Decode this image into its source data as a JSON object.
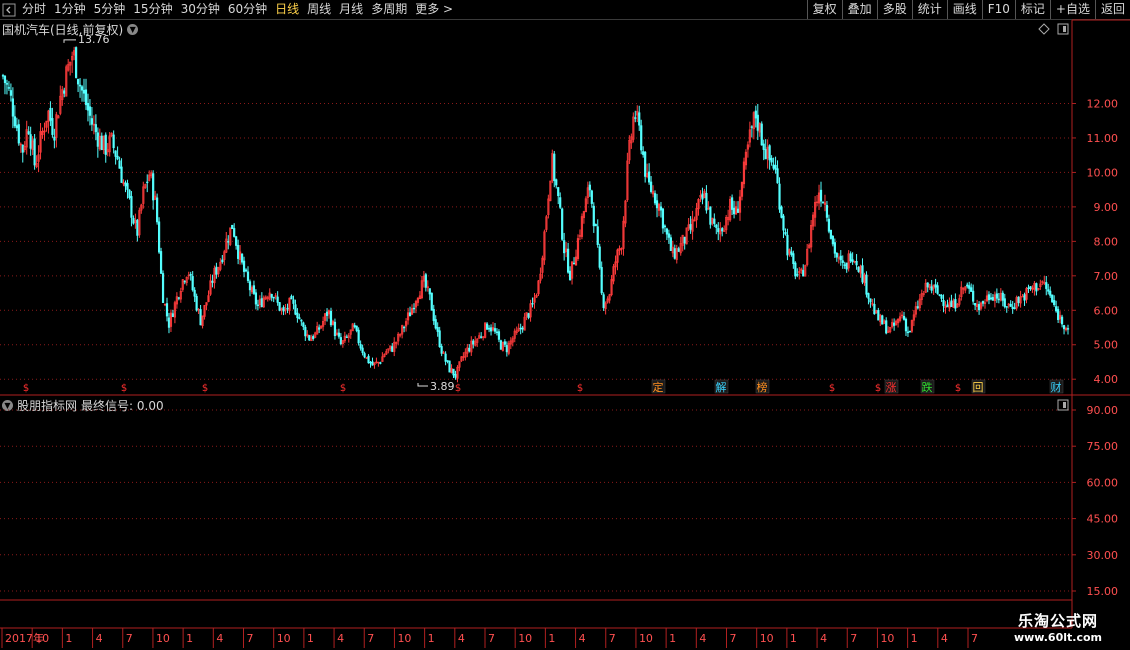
{
  "toolbar": {
    "tabs": [
      {
        "label": "分时",
        "active": false
      },
      {
        "label": "1分钟",
        "active": false
      },
      {
        "label": "5分钟",
        "active": false
      },
      {
        "label": "15分钟",
        "active": false
      },
      {
        "label": "30分钟",
        "active": false
      },
      {
        "label": "60分钟",
        "active": false
      },
      {
        "label": "日线",
        "active": true
      },
      {
        "label": "周线",
        "active": false
      },
      {
        "label": "月线",
        "active": false
      },
      {
        "label": "多周期",
        "active": false
      },
      {
        "label": "更多 >",
        "active": false
      }
    ],
    "right_buttons": [
      "复权",
      "叠加",
      "多股",
      "统计",
      "画线",
      "F10",
      "标记",
      "+自选",
      "返回"
    ]
  },
  "main_chart": {
    "title": "国机汽车(日线,前复权)",
    "high_label": "13.76",
    "low_label": "3.89",
    "y_ticks": [
      "12.00",
      "11.00",
      "10.00",
      "9.00",
      "8.00",
      "7.00",
      "6.00",
      "5.00",
      "4.00"
    ],
    "markers": [
      {
        "text": "$",
        "color": "#ff3030"
      },
      {
        "text": "$",
        "color": "#ff3030"
      },
      {
        "text": "$",
        "color": "#ff3030"
      },
      {
        "text": "$",
        "color": "#ff3030"
      },
      {
        "text": "$",
        "color": "#ff3030"
      },
      {
        "text": "$",
        "color": "#ff3030"
      },
      {
        "text": "定",
        "color": "#ff9020"
      },
      {
        "text": "解",
        "color": "#3ad4ff"
      },
      {
        "text": "榜",
        "color": "#ff9020"
      },
      {
        "text": "$",
        "color": "#ff3030"
      },
      {
        "text": "$",
        "color": "#ff3030"
      },
      {
        "text": "涨",
        "color": "#ff3030"
      },
      {
        "text": "跌",
        "color": "#30e030"
      },
      {
        "text": "$",
        "color": "#ff3030"
      },
      {
        "text": "回",
        "color": "#ffd24a"
      },
      {
        "text": "财",
        "color": "#3ad4ff"
      }
    ]
  },
  "indicator": {
    "title": "股朋指标网",
    "signal_label": "最终信号: 0.00",
    "y_ticks": [
      "90.00",
      "75.00",
      "60.00",
      "45.00",
      "30.00",
      "15.00"
    ]
  },
  "time_axis": [
    "2017年",
    "10",
    "1",
    "4",
    "7",
    "10",
    "1",
    "4",
    "7",
    "10",
    "1",
    "4",
    "7",
    "10",
    "1",
    "4",
    "7",
    "10",
    "1",
    "4",
    "7",
    "10",
    "1",
    "4",
    "7",
    "10",
    "1",
    "4",
    "7",
    "10",
    "1",
    "4",
    "7"
  ],
  "watermark": {
    "line1": "乐淘公式网",
    "line2": "www.60lt.com"
  },
  "chart_data": {
    "type": "candlestick",
    "title": "国机汽车(日线,前复权)",
    "ylim": [
      3.6,
      13.9
    ],
    "y_ticks": [
      4,
      5,
      6,
      7,
      8,
      9,
      10,
      11,
      12
    ],
    "high": 13.76,
    "low": 3.89,
    "close_path": [
      12.8,
      12.3,
      11.5,
      10.6,
      11.4,
      10.2,
      11.0,
      11.8,
      11.2,
      12.2,
      12.9,
      13.5,
      12.6,
      12.0,
      11.4,
      11.0,
      10.7,
      10.9,
      10.4,
      9.6,
      9.0,
      8.2,
      9.4,
      10.0,
      9.0,
      6.5,
      5.6,
      6.2,
      6.8,
      7.2,
      6.4,
      5.7,
      6.3,
      7.0,
      7.4,
      8.0,
      8.5,
      7.6,
      7.0,
      6.5,
      6.1,
      6.4,
      6.6,
      6.2,
      5.9,
      6.2,
      6.0,
      5.5,
      5.2,
      5.3,
      5.6,
      6.0,
      5.4,
      5.0,
      5.2,
      5.5,
      5.0,
      4.6,
      4.4,
      4.5,
      4.8,
      4.9,
      5.2,
      5.6,
      6.0,
      6.5,
      6.8,
      6.3,
      5.4,
      4.7,
      4.3,
      4.1,
      4.6,
      4.9,
      5.1,
      5.3,
      5.6,
      5.4,
      5.0,
      4.9,
      5.2,
      5.4,
      5.8,
      6.1,
      6.8,
      8.4,
      10.4,
      9.3,
      7.8,
      7.0,
      7.9,
      8.8,
      9.6,
      8.2,
      6.2,
      6.4,
      7.4,
      8.0,
      10.3,
      11.8,
      11.0,
      9.7,
      9.4,
      9.0,
      8.2,
      7.6,
      7.8,
      8.1,
      8.4,
      9.0,
      9.3,
      8.6,
      8.2,
      8.5,
      9.0,
      8.8,
      9.8,
      10.9,
      11.7,
      11.0,
      10.4,
      10.2,
      8.9,
      7.8,
      7.2,
      6.9,
      7.5,
      8.8,
      9.5,
      9.1,
      8.0,
      7.4,
      7.2,
      7.7,
      7.4,
      6.9,
      6.3,
      5.8,
      5.6,
      5.4,
      5.6,
      5.9,
      5.3,
      5.9,
      6.4,
      6.7,
      6.6,
      6.4,
      6.2,
      6.1,
      6.5,
      6.7,
      6.4,
      6.1,
      6.3,
      6.5,
      6.4,
      6.2,
      6.1,
      6.3,
      6.4,
      6.6,
      6.7,
      6.8,
      6.5,
      6.0,
      5.7,
      5.5
    ]
  }
}
